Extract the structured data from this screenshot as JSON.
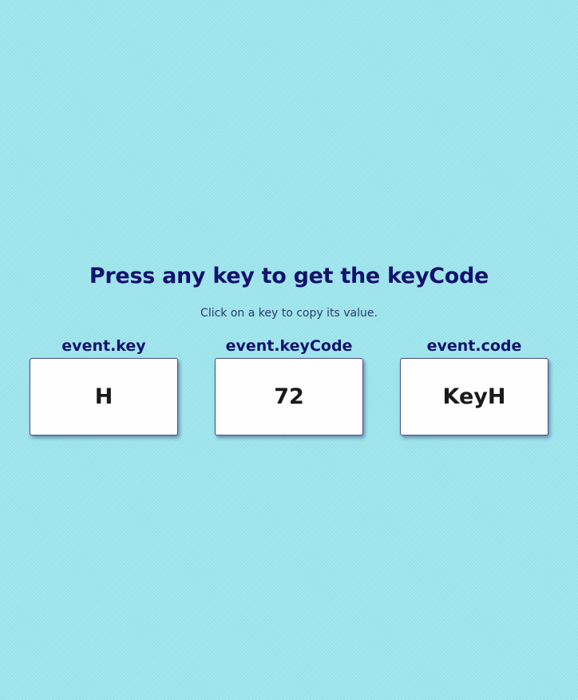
{
  "header": {
    "title": "Press any key to get the keyCode",
    "subtitle": "Click on a key to copy its value."
  },
  "cards": [
    {
      "label": "event.key",
      "value": "H"
    },
    {
      "label": "event.keyCode",
      "value": "72"
    },
    {
      "label": "event.code",
      "value": "KeyH"
    }
  ],
  "colors": {
    "background": "#9fe6ee",
    "heading": "#12126e",
    "card_background": "#fefefe",
    "card_text": "#1a1a1a"
  }
}
